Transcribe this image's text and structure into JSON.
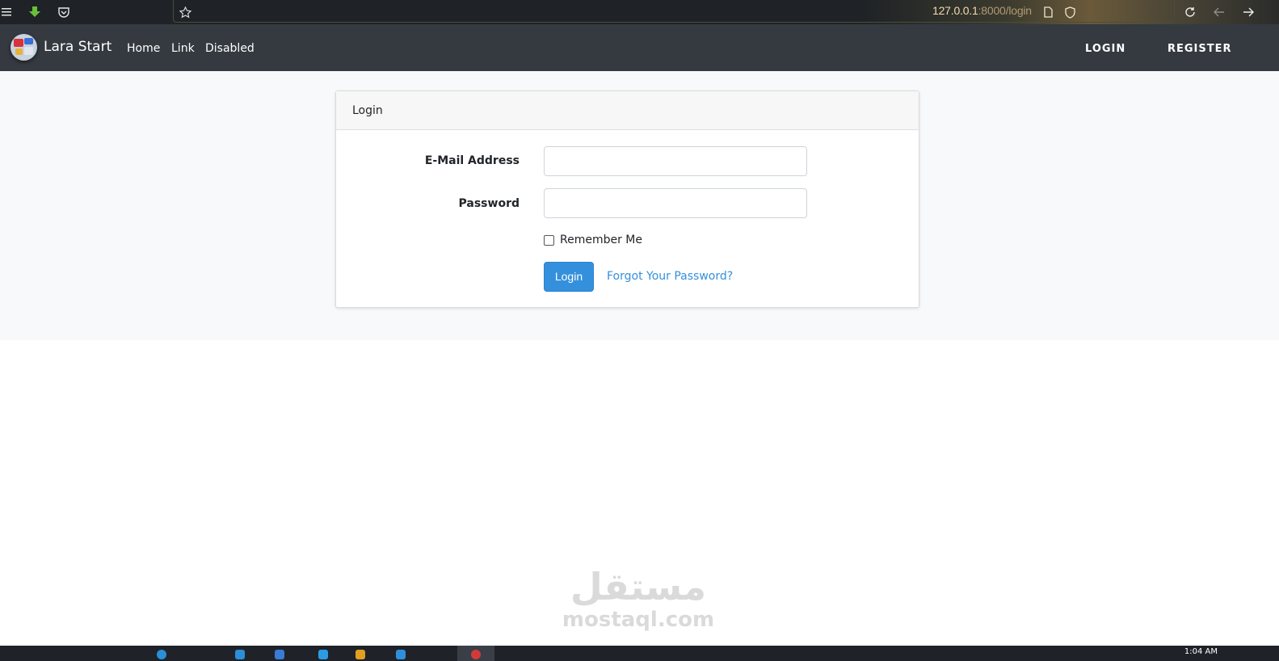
{
  "browser": {
    "url_host": "127.0.0.1",
    "url_rest": ":8000/login",
    "icons": [
      "menu-icon",
      "download-icon",
      "pocket-icon",
      "bookmark-star-icon",
      "page-icon",
      "shield-icon",
      "reload-icon",
      "back-arrow-icon",
      "forward-arrow-icon"
    ]
  },
  "navbar": {
    "brand": "Lara Start",
    "links": [
      "Home",
      "Link",
      "Disabled"
    ],
    "login": "LOGIN",
    "register": "REGISTER"
  },
  "card": {
    "header": "Login",
    "email_label": "E-Mail Address",
    "email_value": "",
    "password_label": "Password",
    "password_value": "",
    "remember_label": "Remember Me",
    "remember_checked": false,
    "login_button": "Login",
    "forgot_link": "Forgot Your Password?"
  },
  "colors": {
    "navbar_bg": "#343a40",
    "primary": "#3490dc",
    "page_bg": "#f8f9fa"
  },
  "watermark": {
    "arabic": "مستقل",
    "latin": "mostaql.com"
  },
  "taskbar": {
    "clock": "1:04 AM"
  }
}
